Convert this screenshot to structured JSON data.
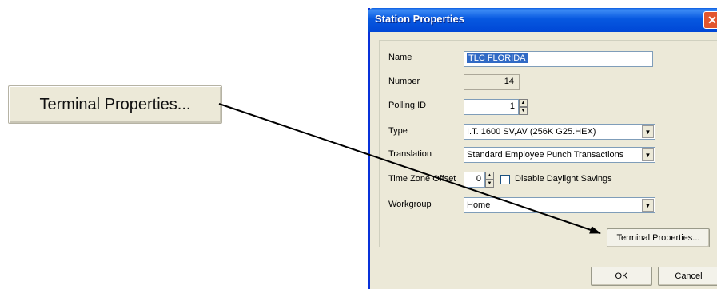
{
  "callout": {
    "button_label": "Terminal Properties..."
  },
  "dialog": {
    "title": "Station Properties",
    "close_glyph": "✕",
    "fields": {
      "name": {
        "label": "Name",
        "value": "TLC FLORIDA"
      },
      "number": {
        "label": "Number",
        "value": "14"
      },
      "polling_id": {
        "label": "Polling ID",
        "value": "1"
      },
      "type": {
        "label": "Type",
        "value": "I.T. 1600 SV,AV (256K G25.HEX)"
      },
      "translation": {
        "label": "Translation",
        "value": "Standard Employee Punch Transactions"
      },
      "time_zone_offset": {
        "label": "Time Zone Offset",
        "value": "0"
      },
      "disable_dst": {
        "label": "Disable Daylight Savings",
        "checked": false
      },
      "workgroup": {
        "label": "Workgroup",
        "value": "Home"
      }
    },
    "buttons": {
      "terminal_properties": "Terminal Properties...",
      "ok": "OK",
      "cancel": "Cancel"
    }
  },
  "icons": {
    "spin_up": "▲",
    "spin_down": "▼",
    "dropdown": "▼"
  }
}
